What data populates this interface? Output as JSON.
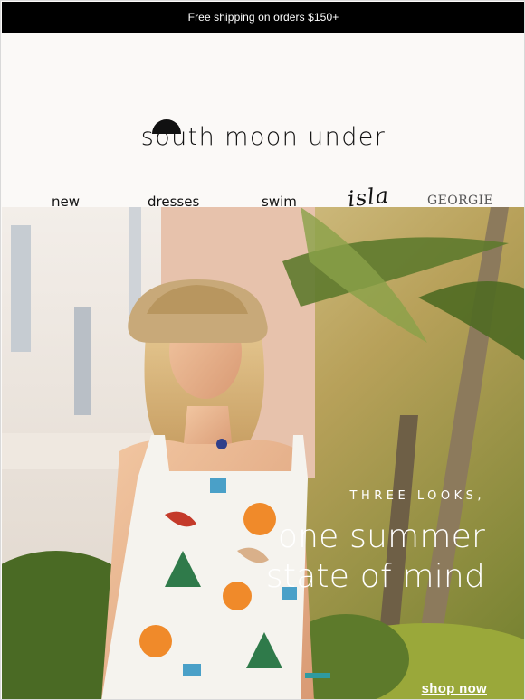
{
  "topbar": {
    "text": "Free shipping on orders $150+"
  },
  "brand": {
    "logo_text": "south moon under",
    "logo_icon": "half-moon-icon"
  },
  "nav": {
    "items": [
      {
        "label": "new"
      },
      {
        "label": "dresses"
      },
      {
        "label": "swim"
      },
      {
        "label": "isla"
      },
      {
        "label": "GEORGIE"
      }
    ]
  },
  "hero": {
    "kicker": "THREE LOOKS,",
    "headline_line1": "one summer",
    "headline_line2": "state of mind",
    "cta_label": "shop now",
    "image_description_icon": "hero-photo"
  },
  "colors": {
    "topbar_bg": "#000000",
    "header_bg": "#fbf9f7",
    "text": "#111111",
    "hero_text": "#ffffff"
  }
}
